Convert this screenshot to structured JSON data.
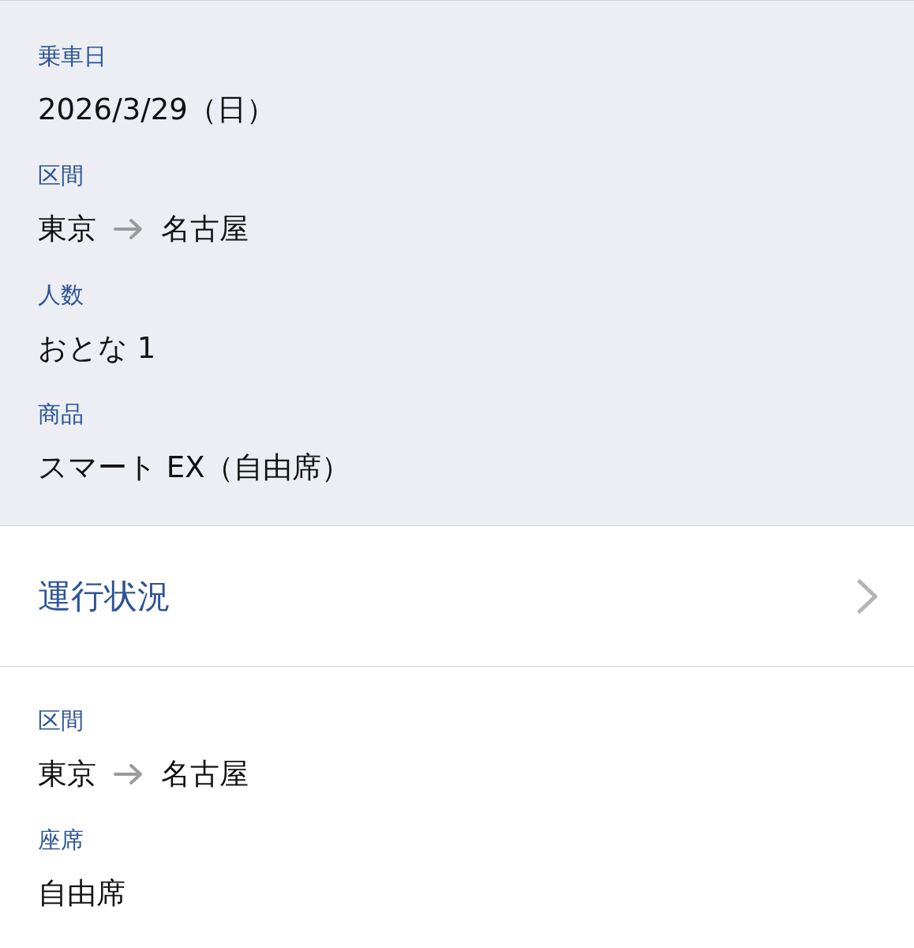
{
  "booking": {
    "fields": [
      {
        "kind": "text",
        "label": "乗車日",
        "value": "2026/3/29（日）"
      },
      {
        "kind": "route",
        "label": "区間",
        "from": "東京",
        "to": "名古屋"
      },
      {
        "kind": "text",
        "label": "人数",
        "value": "おとな 1"
      },
      {
        "kind": "text",
        "label": "商品",
        "value": "スマート EX（自由席）"
      }
    ]
  },
  "status_link": {
    "label": "運行状況"
  },
  "seat": {
    "fields": [
      {
        "kind": "route",
        "label": "区間",
        "from": "東京",
        "to": "名古屋"
      },
      {
        "kind": "text",
        "label": "座席",
        "value": "自由席"
      }
    ]
  }
}
